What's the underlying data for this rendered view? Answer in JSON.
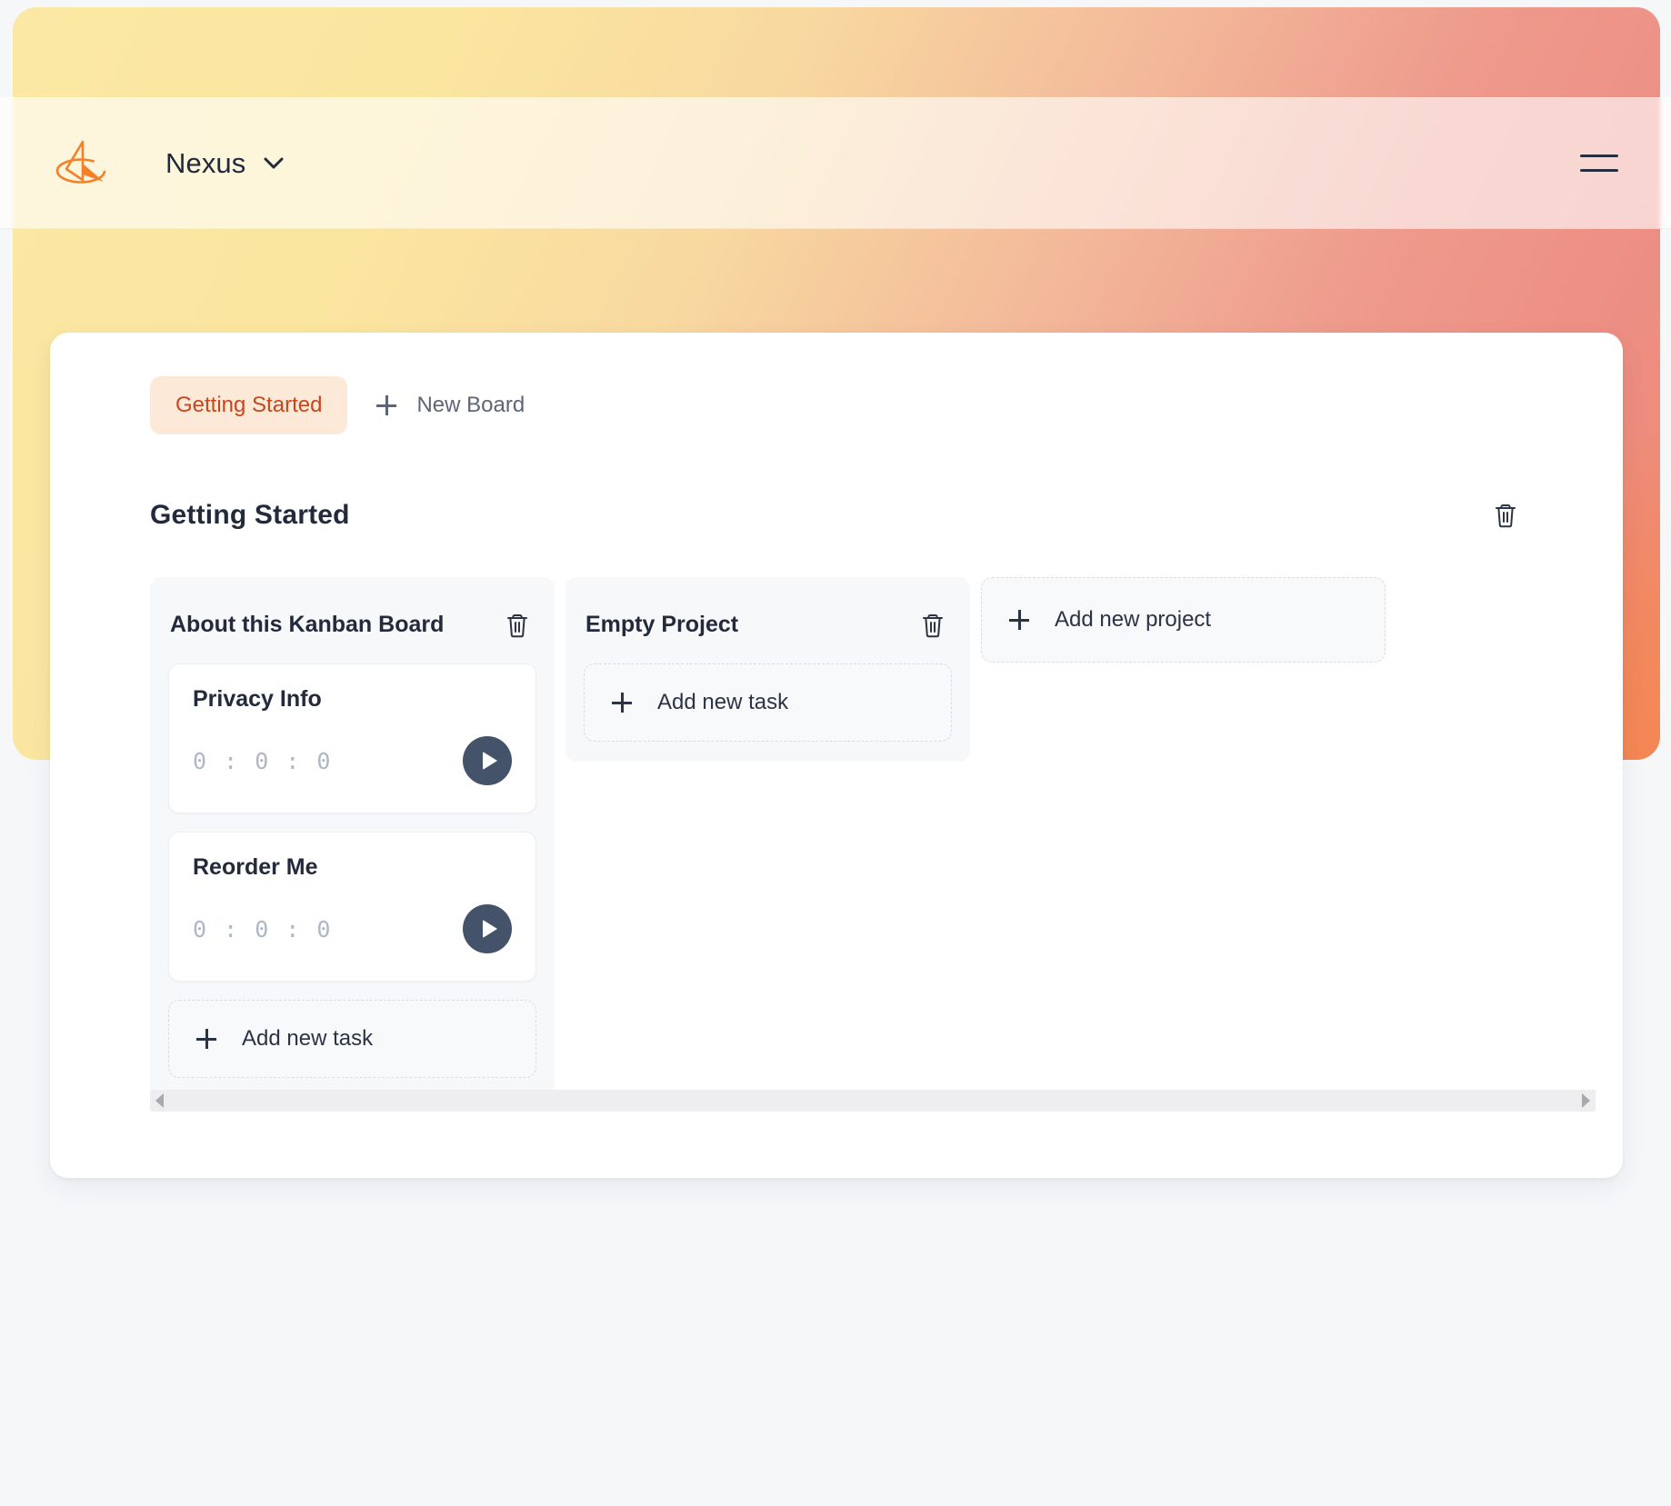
{
  "app": {
    "brand_name": "Nexus",
    "logo_icon": "nexus-sail-logo",
    "menu_icon": "hamburger-menu-icon",
    "dropdown_icon": "chevron-down-icon",
    "accent_color": "#c8461c",
    "accent_bg": "#fde9d8",
    "page_bg": "#f6f7f9",
    "gradient_from": "#fbe8a4",
    "gradient_to": "#f08a6e"
  },
  "board_tabs": {
    "active_tab": "Getting Started",
    "new_board_label": "New Board",
    "new_board_icon": "plus-icon"
  },
  "board": {
    "title": "Getting Started",
    "delete_icon": "trash-icon",
    "add_project_label": "Add new project",
    "add_project_icon": "plus-icon",
    "projects": [
      {
        "title": "About this Kanban Board",
        "delete_icon": "trash-icon",
        "add_task_label": "Add new task",
        "add_task_icon": "plus-icon",
        "tasks": [
          {
            "title": "Privacy Info",
            "timer": "0 : 0 : 0",
            "play_icon": "play-icon"
          },
          {
            "title": "Reorder Me",
            "timer": "0 : 0 : 0",
            "play_icon": "play-icon"
          }
        ]
      },
      {
        "title": "Empty Project",
        "delete_icon": "trash-icon",
        "add_task_label": "Add new task",
        "add_task_icon": "plus-icon",
        "tasks": []
      }
    ]
  },
  "scrollbar": {
    "left_arrow_icon": "caret-left-icon",
    "right_arrow_icon": "caret-right-icon"
  }
}
